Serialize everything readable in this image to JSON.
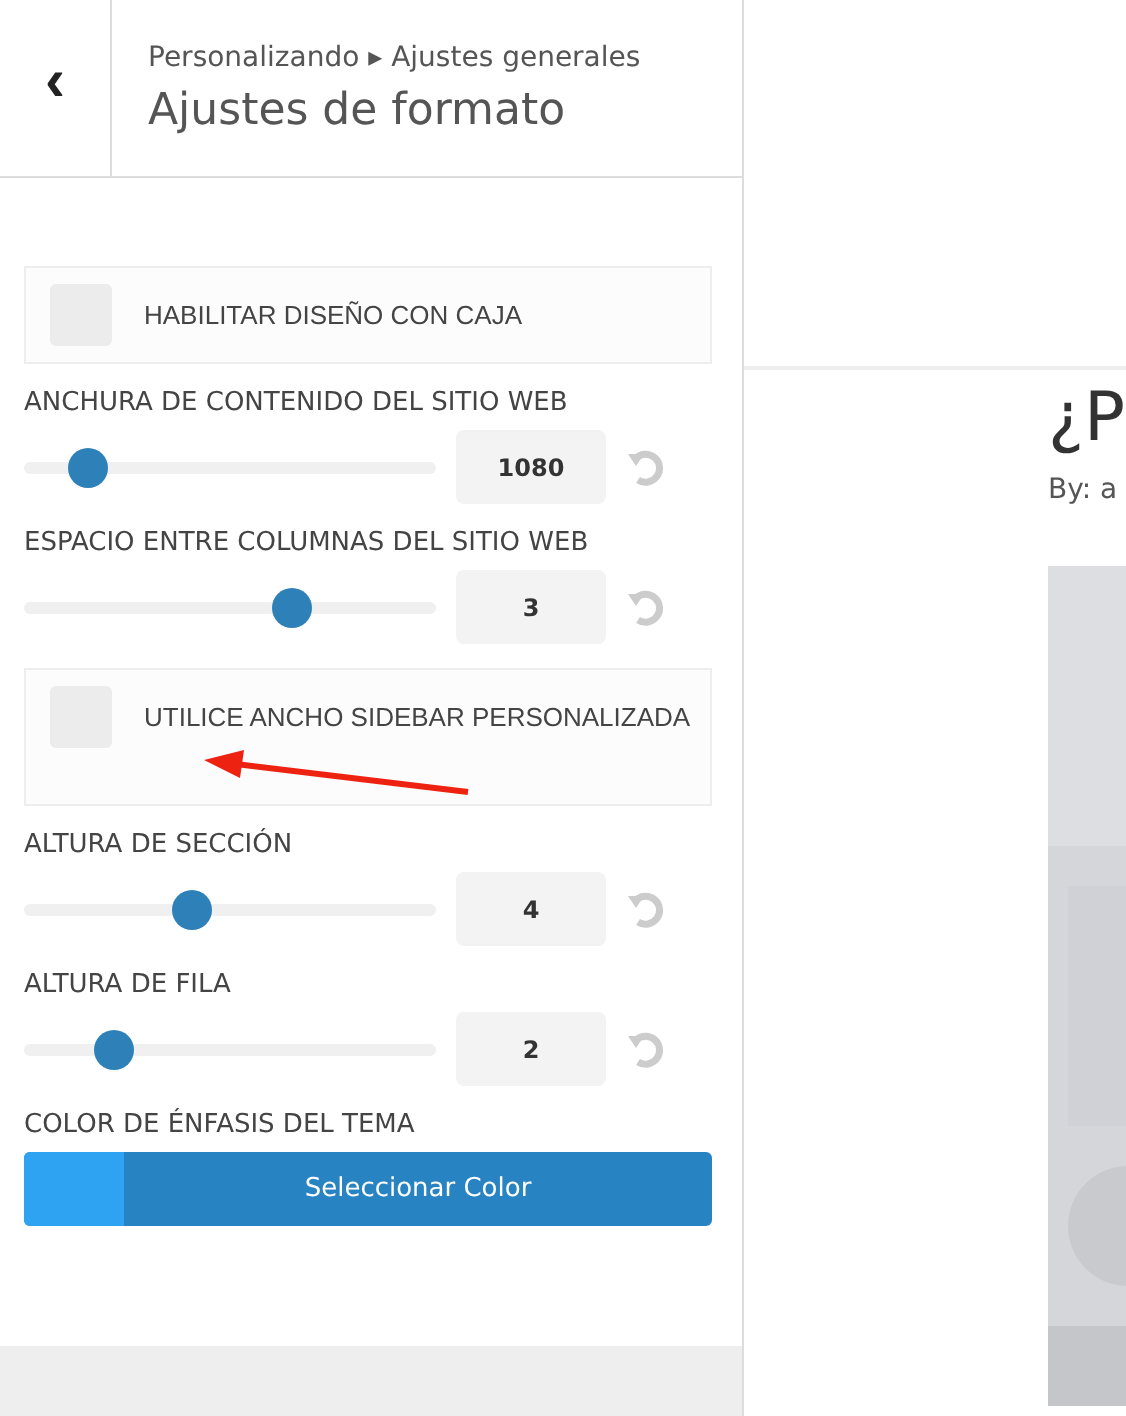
{
  "header": {
    "back": "‹",
    "breadcrumb": [
      "Personalizando",
      "Ajustes generales"
    ],
    "breadcrumb_separator": "▸",
    "title": "Ajustes de formato"
  },
  "controls": [
    {
      "kind": "checkbox",
      "label": "HABILITAR DISEÑO CON CAJA",
      "checked": false
    },
    {
      "kind": "slider",
      "label": "ANCHURA DE CONTENIDO DEL SITIO WEB",
      "level": 0.155,
      "value": "1080"
    },
    {
      "kind": "slider",
      "label": "ESPACIO ENTRE COLUMNAS DEL SITIO WEB",
      "level": 0.65,
      "value": "3"
    },
    {
      "kind": "checkbox",
      "label": "UTILICE ANCHO SIDEBAR PERSONALIZADA",
      "checked": false
    },
    {
      "kind": "slider",
      "label": "ALTURA DE SECCIÓN",
      "level": 0.41,
      "value": "4"
    },
    {
      "kind": "slider",
      "label": "ALTURA DE FILA",
      "level": 0.22,
      "value": "2"
    },
    {
      "kind": "color",
      "label": "COLOR DE ÉNFASIS DEL TEMA",
      "button": "Seleccionar Color",
      "color": "#2ea3f2"
    }
  ],
  "preview": {
    "title": "¿P",
    "byline": "By: a"
  }
}
